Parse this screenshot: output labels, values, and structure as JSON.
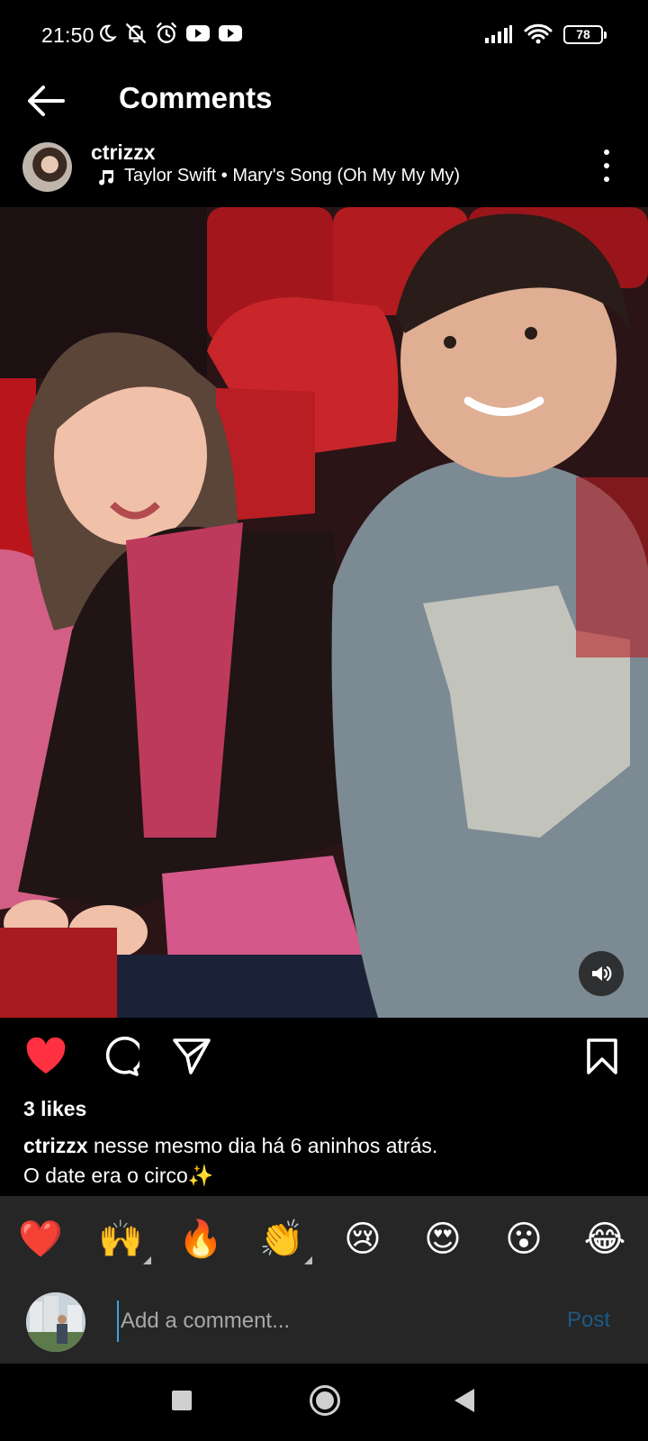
{
  "status_bar": {
    "time": "21:50",
    "battery": "78",
    "left_icons": [
      "moon-icon",
      "bell-off-icon",
      "alarm-icon",
      "youtube-icon",
      "youtube-icon"
    ],
    "right_icons": [
      "signal-icon",
      "wifi-icon",
      "battery-icon"
    ]
  },
  "header": {
    "title": "Comments",
    "back_icon": "arrow-left-icon"
  },
  "post": {
    "username": "ctrizzx",
    "audio": {
      "icon": "music-note-icon",
      "label": "Taylor Swift • Mary's Song (Oh My My My)"
    },
    "media_description_icon": "volume-icon",
    "likes": "3 likes",
    "caption_user": "ctrizzx",
    "caption_line1": "nesse mesmo dia há 6 aninhos atrás.",
    "caption_line2": "O date era o circo✨"
  },
  "actions": {
    "like_icon": "heart-filled-icon",
    "comment_icon": "comment-icon",
    "share_icon": "send-icon",
    "save_icon": "bookmark-icon",
    "like_color": "#ff3040"
  },
  "emoji_reactions": [
    "❤️",
    "🙌",
    "🔥",
    "👏",
    "😢",
    "😍",
    "😮",
    "😂"
  ],
  "comment_box": {
    "placeholder": "Add a comment...",
    "post_label": "Post"
  },
  "colors": {
    "background": "#000000",
    "panel": "#262626",
    "post_disabled": "#1d5a86",
    "cursor": "#3ea0e6"
  }
}
